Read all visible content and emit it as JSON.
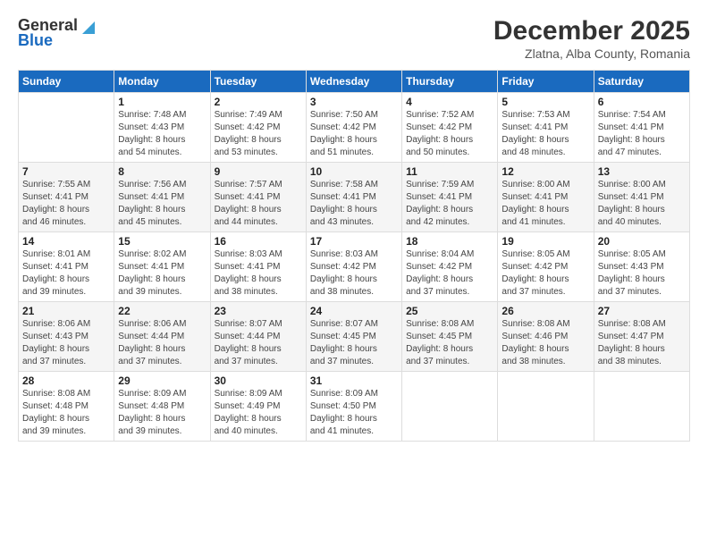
{
  "logo": {
    "line1": "General",
    "line2": "Blue"
  },
  "title": "December 2025",
  "subtitle": "Zlatna, Alba County, Romania",
  "days_header": [
    "Sunday",
    "Monday",
    "Tuesday",
    "Wednesday",
    "Thursday",
    "Friday",
    "Saturday"
  ],
  "weeks": [
    [
      {
        "day": "",
        "info": ""
      },
      {
        "day": "1",
        "info": "Sunrise: 7:48 AM\nSunset: 4:43 PM\nDaylight: 8 hours\nand 54 minutes."
      },
      {
        "day": "2",
        "info": "Sunrise: 7:49 AM\nSunset: 4:42 PM\nDaylight: 8 hours\nand 53 minutes."
      },
      {
        "day": "3",
        "info": "Sunrise: 7:50 AM\nSunset: 4:42 PM\nDaylight: 8 hours\nand 51 minutes."
      },
      {
        "day": "4",
        "info": "Sunrise: 7:52 AM\nSunset: 4:42 PM\nDaylight: 8 hours\nand 50 minutes."
      },
      {
        "day": "5",
        "info": "Sunrise: 7:53 AM\nSunset: 4:41 PM\nDaylight: 8 hours\nand 48 minutes."
      },
      {
        "day": "6",
        "info": "Sunrise: 7:54 AM\nSunset: 4:41 PM\nDaylight: 8 hours\nand 47 minutes."
      }
    ],
    [
      {
        "day": "7",
        "info": "Sunrise: 7:55 AM\nSunset: 4:41 PM\nDaylight: 8 hours\nand 46 minutes."
      },
      {
        "day": "8",
        "info": "Sunrise: 7:56 AM\nSunset: 4:41 PM\nDaylight: 8 hours\nand 45 minutes."
      },
      {
        "day": "9",
        "info": "Sunrise: 7:57 AM\nSunset: 4:41 PM\nDaylight: 8 hours\nand 44 minutes."
      },
      {
        "day": "10",
        "info": "Sunrise: 7:58 AM\nSunset: 4:41 PM\nDaylight: 8 hours\nand 43 minutes."
      },
      {
        "day": "11",
        "info": "Sunrise: 7:59 AM\nSunset: 4:41 PM\nDaylight: 8 hours\nand 42 minutes."
      },
      {
        "day": "12",
        "info": "Sunrise: 8:00 AM\nSunset: 4:41 PM\nDaylight: 8 hours\nand 41 minutes."
      },
      {
        "day": "13",
        "info": "Sunrise: 8:00 AM\nSunset: 4:41 PM\nDaylight: 8 hours\nand 40 minutes."
      }
    ],
    [
      {
        "day": "14",
        "info": "Sunrise: 8:01 AM\nSunset: 4:41 PM\nDaylight: 8 hours\nand 39 minutes."
      },
      {
        "day": "15",
        "info": "Sunrise: 8:02 AM\nSunset: 4:41 PM\nDaylight: 8 hours\nand 39 minutes."
      },
      {
        "day": "16",
        "info": "Sunrise: 8:03 AM\nSunset: 4:41 PM\nDaylight: 8 hours\nand 38 minutes."
      },
      {
        "day": "17",
        "info": "Sunrise: 8:03 AM\nSunset: 4:42 PM\nDaylight: 8 hours\nand 38 minutes."
      },
      {
        "day": "18",
        "info": "Sunrise: 8:04 AM\nSunset: 4:42 PM\nDaylight: 8 hours\nand 37 minutes."
      },
      {
        "day": "19",
        "info": "Sunrise: 8:05 AM\nSunset: 4:42 PM\nDaylight: 8 hours\nand 37 minutes."
      },
      {
        "day": "20",
        "info": "Sunrise: 8:05 AM\nSunset: 4:43 PM\nDaylight: 8 hours\nand 37 minutes."
      }
    ],
    [
      {
        "day": "21",
        "info": "Sunrise: 8:06 AM\nSunset: 4:43 PM\nDaylight: 8 hours\nand 37 minutes."
      },
      {
        "day": "22",
        "info": "Sunrise: 8:06 AM\nSunset: 4:44 PM\nDaylight: 8 hours\nand 37 minutes."
      },
      {
        "day": "23",
        "info": "Sunrise: 8:07 AM\nSunset: 4:44 PM\nDaylight: 8 hours\nand 37 minutes."
      },
      {
        "day": "24",
        "info": "Sunrise: 8:07 AM\nSunset: 4:45 PM\nDaylight: 8 hours\nand 37 minutes."
      },
      {
        "day": "25",
        "info": "Sunrise: 8:08 AM\nSunset: 4:45 PM\nDaylight: 8 hours\nand 37 minutes."
      },
      {
        "day": "26",
        "info": "Sunrise: 8:08 AM\nSunset: 4:46 PM\nDaylight: 8 hours\nand 38 minutes."
      },
      {
        "day": "27",
        "info": "Sunrise: 8:08 AM\nSunset: 4:47 PM\nDaylight: 8 hours\nand 38 minutes."
      }
    ],
    [
      {
        "day": "28",
        "info": "Sunrise: 8:08 AM\nSunset: 4:48 PM\nDaylight: 8 hours\nand 39 minutes."
      },
      {
        "day": "29",
        "info": "Sunrise: 8:09 AM\nSunset: 4:48 PM\nDaylight: 8 hours\nand 39 minutes."
      },
      {
        "day": "30",
        "info": "Sunrise: 8:09 AM\nSunset: 4:49 PM\nDaylight: 8 hours\nand 40 minutes."
      },
      {
        "day": "31",
        "info": "Sunrise: 8:09 AM\nSunset: 4:50 PM\nDaylight: 8 hours\nand 41 minutes."
      },
      {
        "day": "",
        "info": ""
      },
      {
        "day": "",
        "info": ""
      },
      {
        "day": "",
        "info": ""
      }
    ]
  ]
}
